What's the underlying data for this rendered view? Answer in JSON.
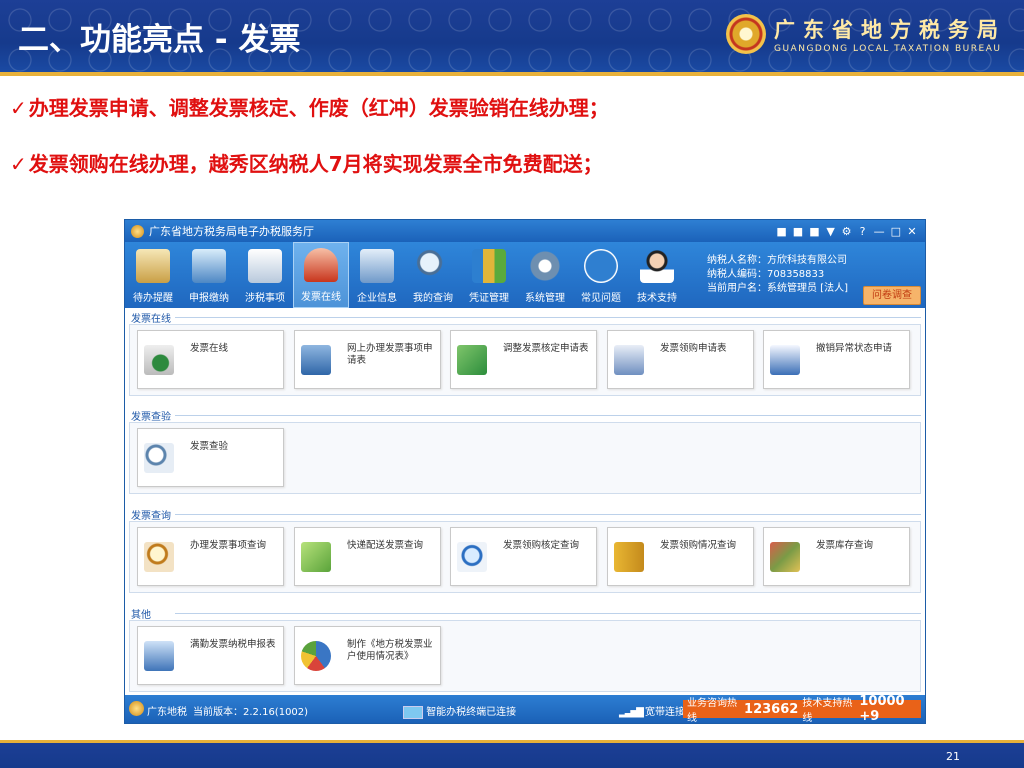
{
  "slide": {
    "title": "二、功能亮点 - 发票",
    "bureau_cn": "广东省地方税务局",
    "bureau_en": "GUANGDONG LOCAL TAXATION BUREAU",
    "bullets": [
      "办理发票申请、调整发票核定、作废（红冲）发票验销在线办理；",
      "发票领购在线办理，越秀区纳税人7月将实现发票全市免费配送；"
    ],
    "check": "✓",
    "page_number": "21"
  },
  "app": {
    "title": "广东省地方税务局电子办税服务厅",
    "window_controls": [
      "■",
      "■",
      "■",
      "▼",
      "⚙",
      "?",
      "—",
      "□",
      "✕"
    ],
    "toolbar": [
      {
        "label": "待办提醒",
        "icon": "clipboard-icon"
      },
      {
        "label": "申报缴纳",
        "icon": "monitor-icon"
      },
      {
        "label": "涉税事项",
        "icon": "form-icon"
      },
      {
        "label": "发票在线",
        "icon": "stamp-icon"
      },
      {
        "label": "企业信息",
        "icon": "building-icon"
      },
      {
        "label": "我的查询",
        "icon": "magnifier-icon"
      },
      {
        "label": "凭证管理",
        "icon": "binders-icon"
      },
      {
        "label": "系统管理",
        "icon": "gear-icon"
      },
      {
        "label": "常见问题",
        "icon": "question-icon"
      },
      {
        "label": "技术支持",
        "icon": "support-agent-icon"
      }
    ],
    "taxpayer": {
      "name_line": "纳税人名称：方欣科技有限公司",
      "code_line": "纳税人编码：708358833",
      "user_line": "当前用户名：系统管理员 [法人]"
    },
    "survey_button": "问卷调查",
    "sections": [
      {
        "title": "发票在线",
        "tiles": [
          "发票在线",
          "网上办理发票事项申请表",
          "调整发票核定申请表",
          "发票领购申请表",
          "撤销异常状态申请"
        ]
      },
      {
        "title": "发票查验",
        "tiles": [
          "发票查验"
        ]
      },
      {
        "title": "发票查询",
        "tiles": [
          "办理发票事项查询",
          "快递配送发票查询",
          "发票领购核定查询",
          "发票领购情况查询",
          "发票库存查询"
        ]
      },
      {
        "title": "其他",
        "tiles": [
          "满勤发票纳税申报表",
          "制作《地方税发票业户使用情况表》"
        ]
      }
    ],
    "status": {
      "brand": "广东地税",
      "version": "当前版本：2.2.16(1002)",
      "terminal": "智能办税终端已连接",
      "broadband": "宽带连接",
      "hotline_label": "业务咨询热线",
      "hotline_number": "123662",
      "support_label": "技术支持热线",
      "support_number": "10000 +9"
    }
  }
}
